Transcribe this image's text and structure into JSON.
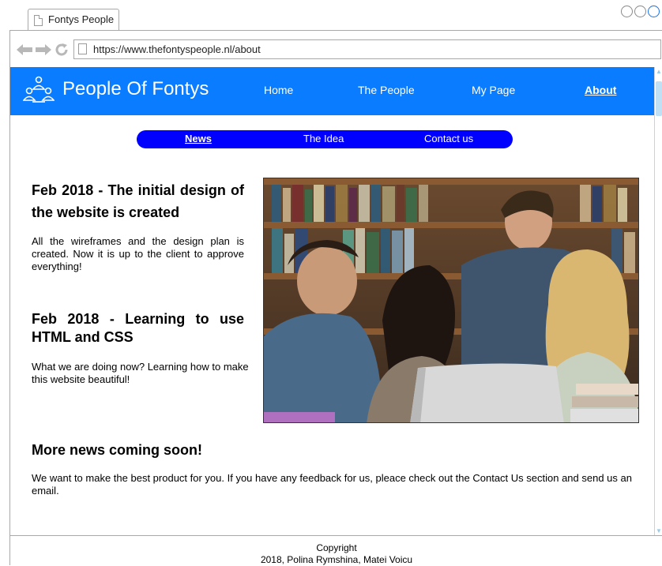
{
  "browser": {
    "tab_title": "Fontys People",
    "url": "https://www.thefontyspeople.nl/about",
    "back_icon": "arrow-left-icon",
    "forward_icon": "arrow-right-icon",
    "reload_icon": "reload-icon"
  },
  "site": {
    "brand": "People Of Fontys",
    "nav": [
      "Home",
      "The People",
      "My Page",
      "About"
    ],
    "active_nav": "About",
    "subnav": [
      "News",
      "The Idea",
      "Contact us"
    ],
    "active_subnav": "News",
    "colors": {
      "header": "#0a7cff",
      "subnav": "#0000ff"
    }
  },
  "news": [
    {
      "title": "Feb 2018 - The initial design of the website is created",
      "body": "All the wireframes and the design plan is created. Now it is up to the client to approve everything!"
    },
    {
      "title": "Feb 2018 - Learning to use HTML and CSS",
      "body": "What we are doing now? Learning how to make this website beautiful!"
    }
  ],
  "more": {
    "title": "More news coming soon!",
    "body": "We want to make the best product for you. If you have any feedback for us, pleace check out the Contact Us section and send us an email."
  },
  "footer": {
    "line1": "Copyright",
    "line2": "2018, Polina Rymshina, Matei Voicu"
  }
}
